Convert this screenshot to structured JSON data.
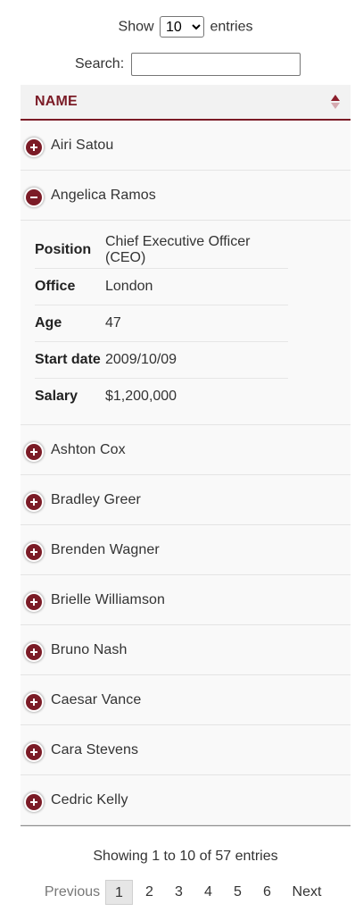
{
  "length": {
    "label_before": "Show",
    "selected": "10",
    "label_after": "entries"
  },
  "search": {
    "label": "Search:",
    "value": "",
    "placeholder": ""
  },
  "table": {
    "header": {
      "name": "NAME"
    },
    "rows": [
      {
        "name": "Airi Satou"
      },
      {
        "name": "Angelica Ramos"
      },
      {
        "name": "Ashton Cox"
      },
      {
        "name": "Bradley Greer"
      },
      {
        "name": "Brenden Wagner"
      },
      {
        "name": "Brielle Williamson"
      },
      {
        "name": "Bruno Nash"
      },
      {
        "name": "Caesar Vance"
      },
      {
        "name": "Cara Stevens"
      },
      {
        "name": "Cedric Kelly"
      }
    ],
    "expanded": {
      "fields": [
        {
          "label": "Position",
          "value": "Chief Executive Officer (CEO)"
        },
        {
          "label": "Office",
          "value": "London"
        },
        {
          "label": "Age",
          "value": "47"
        },
        {
          "label": "Start date",
          "value": "2009/10/09"
        },
        {
          "label": "Salary",
          "value": "$1,200,000"
        }
      ]
    }
  },
  "info": "Showing 1 to 10 of 57 entries",
  "pagination": {
    "previous": "Previous",
    "pages": [
      "1",
      "2",
      "3",
      "4",
      "5",
      "6"
    ],
    "current": "1",
    "next": "Next"
  }
}
